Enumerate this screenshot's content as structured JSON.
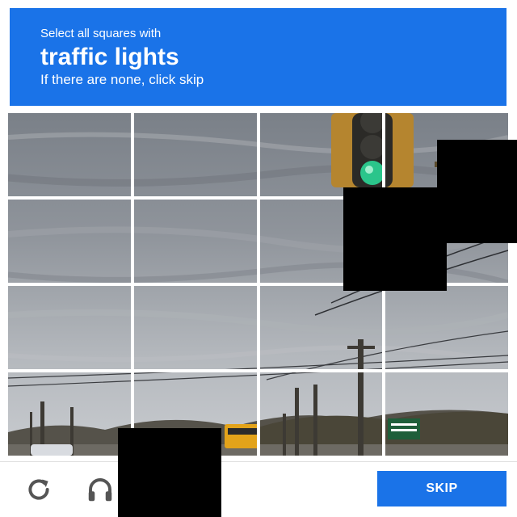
{
  "header": {
    "lead": "Select all squares with",
    "target": "traffic lights",
    "note": "If there are none, click skip",
    "color": "#1a73e8"
  },
  "grid": {
    "rows": 4,
    "columns": 4,
    "tiles": [
      {
        "row": 1,
        "col": 1,
        "content": "sky"
      },
      {
        "row": 1,
        "col": 2,
        "content": "sky"
      },
      {
        "row": 1,
        "col": 3,
        "content": "sky"
      },
      {
        "row": 1,
        "col": 4,
        "content": "traffic light with green signal"
      },
      {
        "row": 2,
        "col": 1,
        "content": "sky"
      },
      {
        "row": 2,
        "col": 2,
        "content": "sky"
      },
      {
        "row": 2,
        "col": 3,
        "content": "sky"
      },
      {
        "row": 2,
        "col": 4,
        "content": "sky and wires"
      },
      {
        "row": 3,
        "col": 1,
        "content": "sky"
      },
      {
        "row": 3,
        "col": 2,
        "content": "sky"
      },
      {
        "row": 3,
        "col": 3,
        "content": "sky and wires"
      },
      {
        "row": 3,
        "col": 4,
        "content": "utility pole and wires"
      },
      {
        "row": 4,
        "col": 1,
        "content": "road, car and poles"
      },
      {
        "row": 4,
        "col": 2,
        "content": "school bus"
      },
      {
        "row": 4,
        "col": 3,
        "content": "utility poles and trees"
      },
      {
        "row": 4,
        "col": 4,
        "content": "sign and trees"
      }
    ]
  },
  "footer": {
    "reload_icon": "reload-icon",
    "audio_icon": "headphones-icon",
    "skip_label": "SKIP",
    "skip_color": "#1a73e8"
  }
}
